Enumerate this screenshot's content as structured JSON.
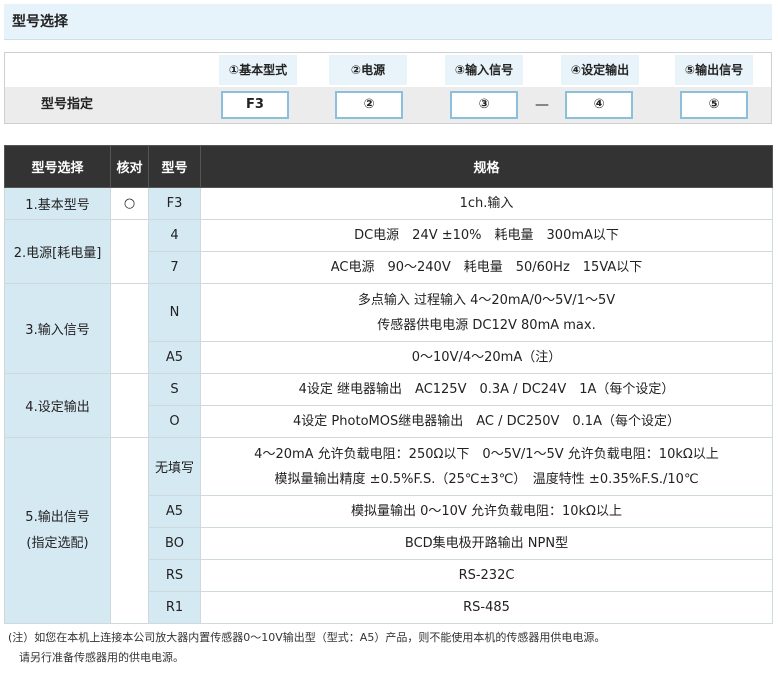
{
  "title": "型号选择",
  "spec_builder": {
    "row_label": "型号指定",
    "columns": [
      {
        "head": "①基本型式",
        "value": "F3"
      },
      {
        "head": "②电源",
        "value": "②"
      },
      {
        "head": "③输入信号",
        "value": "③"
      },
      {
        "head": "④设定输出",
        "value": "④"
      },
      {
        "head": "⑤输出信号",
        "value": "⑤"
      }
    ],
    "dash": "—"
  },
  "table": {
    "headers": [
      "型号选择",
      "核对",
      "型号",
      "规格"
    ],
    "groups": [
      {
        "category": "1.基本型号",
        "check": "○",
        "rows": [
          {
            "code": "F3",
            "spec": [
              "1ch.输入"
            ]
          }
        ]
      },
      {
        "category": "2.电源[耗电量]",
        "check": "",
        "rows": [
          {
            "code": "4",
            "spec": [
              "DC电源　24V ±10%　耗电量　300mA以下"
            ]
          },
          {
            "code": "7",
            "spec": [
              "AC电源　90～240V　耗电量　50/60Hz　15VA以下"
            ]
          }
        ]
      },
      {
        "category": "3.输入信号",
        "check": "",
        "rows": [
          {
            "code": "N",
            "spec": [
              "多点输入 过程输入 4～20mA/0～5V/1～5V",
              "传感器供电电源 DC12V 80mA max."
            ]
          },
          {
            "code": "A5",
            "spec": [
              "0～10V/4～20mA（注）"
            ]
          }
        ]
      },
      {
        "category": "4.设定输出",
        "check": "",
        "rows": [
          {
            "code": "S",
            "spec": [
              "4设定 继电器输出　AC125V　0.3A / DC24V　1A（每个设定）"
            ]
          },
          {
            "code": "O",
            "spec": [
              "4设定 PhotoMOS继电器输出　AC / DC250V　0.1A（每个设定）"
            ]
          }
        ]
      },
      {
        "category": "5.输出信号",
        "category_sub": "(指定选配)",
        "check": "",
        "rows": [
          {
            "code": "无填写",
            "spec": [
              "4～20mA 允许负载电阻：250Ω以下　0～5V/1～5V 允许负载电阻：10kΩ以上",
              "模拟量输出精度 ±0.5%F.S.（25℃±3℃）　温度特性 ±0.35%F.S./10℃"
            ]
          },
          {
            "code": "A5",
            "spec": [
              "模拟量输出 0～10V 允许负载电阻：10kΩ以上"
            ]
          },
          {
            "code": "BO",
            "spec": [
              "BCD集电极开路输出 NPN型"
            ]
          },
          {
            "code": "RS",
            "spec": [
              "RS-232C"
            ]
          },
          {
            "code": "R1",
            "spec": [
              "RS-485"
            ]
          }
        ]
      }
    ]
  },
  "note": [
    "(注）如您在本机上连接本公司放大器内置传感器0～10V输出型（型式：A5）产品，则不能使用本机的传感器用供电电源。",
    "　请另行准备传感器用的供电电源。"
  ]
}
